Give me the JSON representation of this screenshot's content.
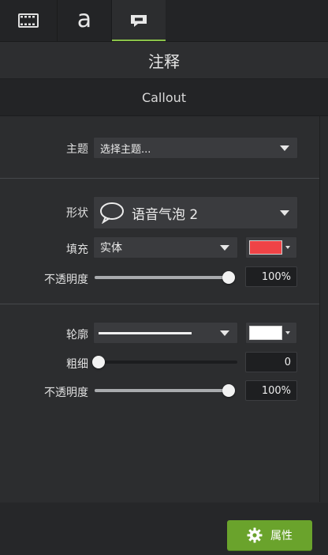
{
  "tabs": [
    {
      "name": "media-tab",
      "icon": "film-strip-icon"
    },
    {
      "name": "text-tab",
      "label": "a"
    },
    {
      "name": "callout-tab",
      "icon": "callout-icon",
      "active": true
    }
  ],
  "header": {
    "title_cn": "注释",
    "title_en": "Callout"
  },
  "theme": {
    "label": "主题",
    "value": "选择主题..."
  },
  "shape": {
    "label": "形状",
    "value": "语音气泡 2",
    "icon": "speech-bubble-icon"
  },
  "fill": {
    "label": "填充",
    "value": "实体",
    "color": "#ef4346"
  },
  "fill_opacity": {
    "label": "不透明度",
    "value": "100%",
    "level": 1.0
  },
  "outline": {
    "label": "轮廓",
    "color": "#ffffff"
  },
  "thickness": {
    "label": "粗细",
    "value": "0",
    "level": 0.0
  },
  "outline_opacity": {
    "label": "不透明度",
    "value": "100%",
    "level": 1.0
  },
  "footer": {
    "properties_label": "属性",
    "icon": "gear-icon"
  },
  "colors": {
    "accent": "#6aa32c",
    "active_tab": "#8bc34a"
  }
}
